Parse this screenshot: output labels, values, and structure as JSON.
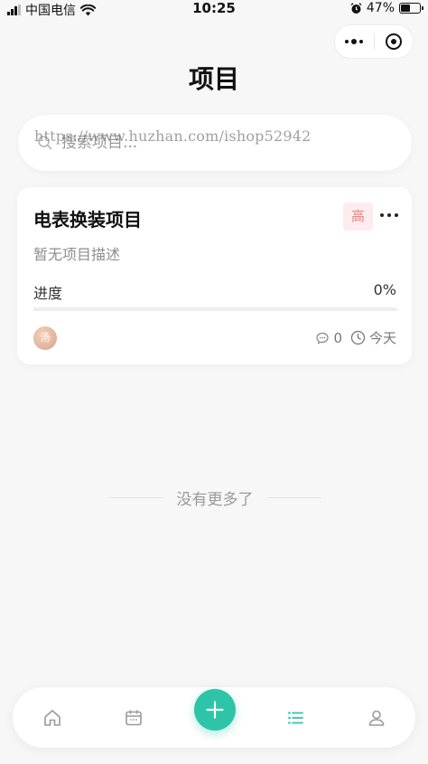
{
  "status_bar": {
    "carrier": "中国电信",
    "time": "10:25",
    "battery_percent": "47%",
    "battery_level": 0.47
  },
  "capsule": {
    "more_icon": "more-dots-icon",
    "close_icon": "target-circle-icon"
  },
  "page": {
    "title": "项目"
  },
  "search": {
    "placeholder": "搜索项目...",
    "watermark": "https://www.huzhan.com/ishop52942"
  },
  "projects": [
    {
      "name": "电表换装项目",
      "priority": "高",
      "description": "暂无项目描述",
      "progress_label": "进度",
      "progress_text": "0%",
      "progress": 0,
      "avatar_text": "汤",
      "comments": "0",
      "date": "今天"
    }
  ],
  "list_end": "没有更多了",
  "tabbar": {
    "items": [
      {
        "icon": "home-icon"
      },
      {
        "icon": "calendar-icon"
      },
      {
        "icon": "plus-icon"
      },
      {
        "icon": "list-icon",
        "active": true
      },
      {
        "icon": "user-icon"
      }
    ]
  },
  "colors": {
    "accent": "#2ec4a8",
    "background": "#f7f7f7",
    "priority_bg": "#fdecee",
    "priority_text": "#e8837f"
  }
}
